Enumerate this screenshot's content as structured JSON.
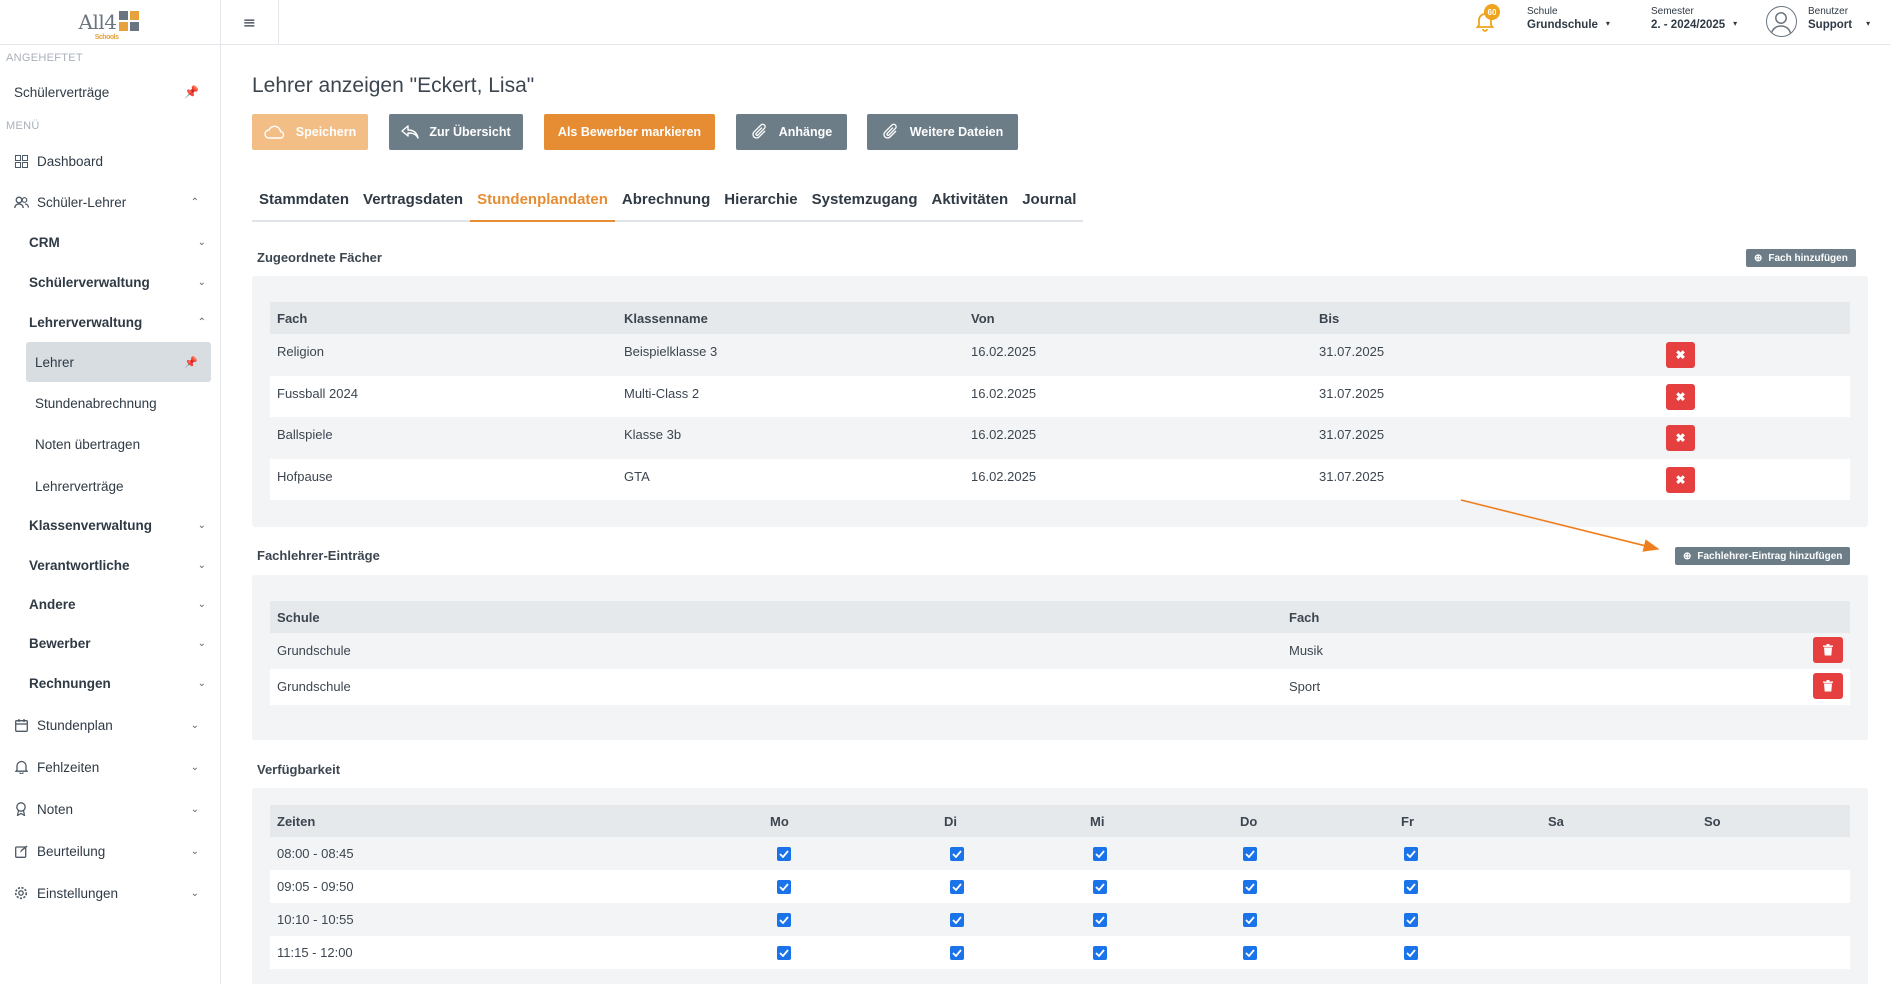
{
  "brand": {
    "logo_text": "All4",
    "logo_sub": "Schools"
  },
  "sidebar": {
    "pinned_label": "ANGEHEFTET",
    "pinned_item": "Schülerverträge",
    "menu_label": "MENÜ",
    "items": [
      {
        "label": "Dashboard",
        "icon": "grid-icon"
      },
      {
        "label": "Schüler-Lehrer",
        "icon": "users-icon",
        "expanded": true
      },
      {
        "label": "Stundenplan",
        "icon": "calendar-icon"
      },
      {
        "label": "Fehlzeiten",
        "icon": "bell-icon"
      },
      {
        "label": "Noten",
        "icon": "award-icon"
      },
      {
        "label": "Beurteilung",
        "icon": "edit-icon"
      },
      {
        "label": "Einstellungen",
        "icon": "gear-icon"
      }
    ],
    "sub_items": [
      "CRM",
      "Schülerverwaltung",
      "Lehrerverwaltung",
      "Klassenverwaltung",
      "Verantwortliche",
      "Andere",
      "Bewerber",
      "Rechnungen"
    ],
    "leaf_items": [
      "Lehrer",
      "Stundenabrechnung",
      "Noten übertragen",
      "Lehrerverträge"
    ]
  },
  "topbar": {
    "notification_count": "60",
    "school_label": "Schule",
    "school_value": "Grundschule",
    "semester_label": "Semester",
    "semester_value": "2. - 2024/2025",
    "user_label": "Benutzer",
    "user_value": "Support"
  },
  "page": {
    "title": "Lehrer anzeigen \"Eckert, Lisa\"",
    "buttons": {
      "save": "Speichern",
      "overview": "Zur Übersicht",
      "applicant": "Als Bewerber markieren",
      "attachments": "Anhänge",
      "more_files": "Weitere Dateien"
    },
    "tabs": [
      "Stammdaten",
      "Vertragsdaten",
      "Stundenplandaten",
      "Abrechnung",
      "Hierarchie",
      "Systemzugang",
      "Aktivitäten",
      "Journal"
    ],
    "active_tab": "Stundenplandaten"
  },
  "subjects": {
    "title": "Zugeordnete Fächer",
    "add_button": "Fach hinzufügen",
    "headers": [
      "Fach",
      "Klassenname",
      "Von",
      "Bis"
    ],
    "rows": [
      {
        "fach": "Religion",
        "klasse": "Beispielklasse 3",
        "von": "16.02.2025",
        "bis": "31.07.2025"
      },
      {
        "fach": "Fussball 2024",
        "klasse": "Multi-Class 2",
        "von": "16.02.2025",
        "bis": "31.07.2025"
      },
      {
        "fach": "Ballspiele",
        "klasse": "Klasse 3b",
        "von": "16.02.2025",
        "bis": "31.07.2025"
      },
      {
        "fach": "Hofpause",
        "klasse": "GTA",
        "von": "16.02.2025",
        "bis": "31.07.2025"
      }
    ]
  },
  "subject_teacher": {
    "title": "Fachlehrer-Einträge",
    "add_button": "Fachlehrer-Eintrag hinzufügen",
    "headers": [
      "Schule",
      "Fach"
    ],
    "rows": [
      {
        "schule": "Grundschule",
        "fach": "Musik"
      },
      {
        "schule": "Grundschule",
        "fach": "Sport"
      }
    ]
  },
  "availability": {
    "title": "Verfügbarkeit",
    "headers": [
      "Zeiten",
      "Mo",
      "Di",
      "Mi",
      "Do",
      "Fr",
      "Sa",
      "So"
    ],
    "rows": [
      {
        "time": "08:00 - 08:45",
        "checked": [
          true,
          true,
          true,
          true,
          true,
          false,
          false
        ]
      },
      {
        "time": "09:05 - 09:50",
        "checked": [
          true,
          true,
          true,
          true,
          true,
          false,
          false
        ]
      },
      {
        "time": "10:10 - 10:55",
        "checked": [
          true,
          true,
          true,
          true,
          true,
          false,
          false
        ]
      },
      {
        "time": "11:15 - 12:00",
        "checked": [
          true,
          true,
          true,
          true,
          true,
          false,
          false
        ]
      }
    ]
  },
  "colors": {
    "accent": "#e68d33",
    "danger": "#e53f3f",
    "secondary": "#6c7d88",
    "checkbox": "#1a73e8"
  }
}
